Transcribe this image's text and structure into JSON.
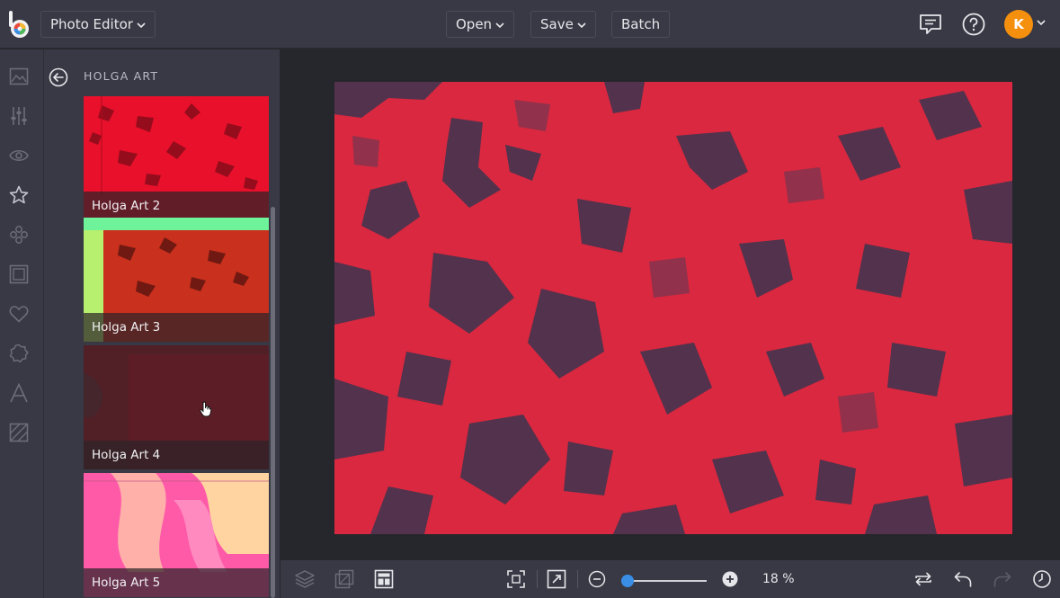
{
  "header": {
    "mode_label": "Photo Editor",
    "open_label": "Open",
    "save_label": "Save",
    "batch_label": "Batch",
    "user_initial": "K"
  },
  "rail": {
    "items": [
      {
        "icon": "image-icon"
      },
      {
        "icon": "sliders-icon"
      },
      {
        "icon": "eye-icon"
      },
      {
        "icon": "star-icon"
      },
      {
        "icon": "overlays-icon"
      },
      {
        "icon": "frame-icon"
      },
      {
        "icon": "heart-icon"
      },
      {
        "icon": "badge-icon"
      },
      {
        "icon": "text-icon"
      },
      {
        "icon": "texture-icon"
      }
    ]
  },
  "panel": {
    "title": "HOLGA ART",
    "effects": [
      {
        "label": "Holga Art 2"
      },
      {
        "label": "Holga Art 3"
      },
      {
        "label": "Holga Art 4"
      },
      {
        "label": "Holga Art 5"
      }
    ]
  },
  "footer": {
    "zoom_percent": 18,
    "zoom_text": "18 %",
    "zoom_slider_fraction": 0.0
  },
  "colors": {
    "accent": "#3a8ee6",
    "avatar": "#f5900f",
    "photo_tint": "#d9283f"
  }
}
